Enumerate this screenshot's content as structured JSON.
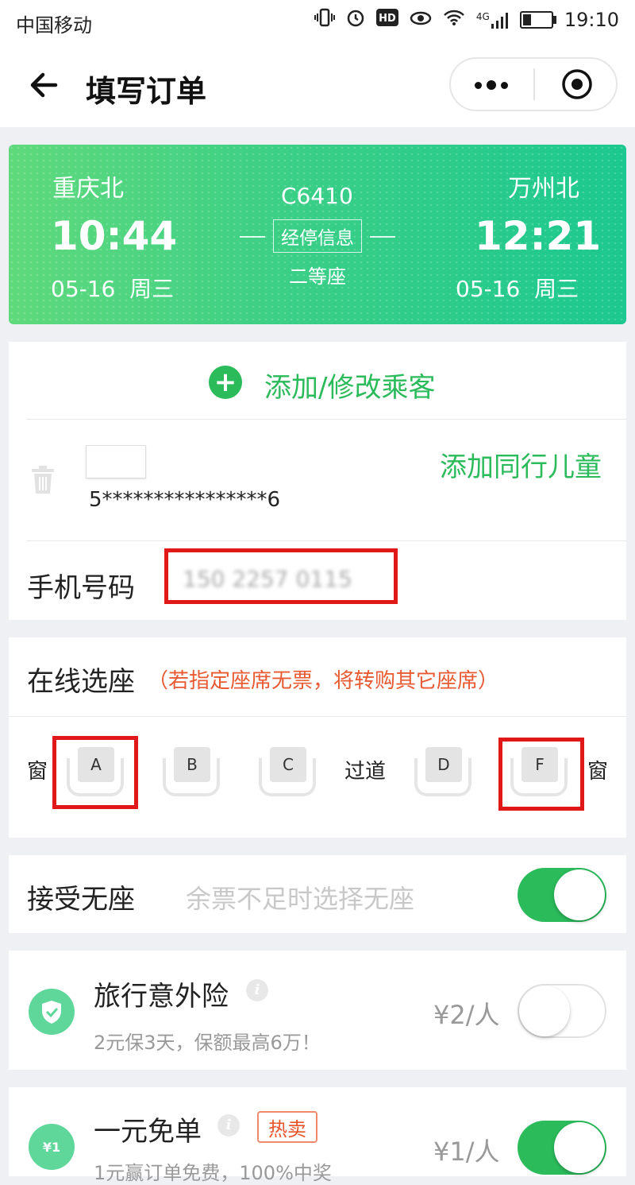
{
  "status_bar": {
    "carrier": "中国移动",
    "network": "4G",
    "time": "19:10"
  },
  "nav": {
    "title": "填写订单"
  },
  "train": {
    "from_station": "重庆北",
    "from_time": "10:44",
    "from_date": "05-16  周三",
    "to_station": "万州北",
    "to_time": "12:21",
    "to_date": "05-16  周三",
    "train_no": "C6410",
    "stop_info_label": "经停信息",
    "seat_class": "二等座"
  },
  "passenger": {
    "add_label": "添加/修改乘客",
    "id_number": "5****************6",
    "add_child_label": "添加同行儿童",
    "phone_label": "手机号码",
    "phone_value": "150 2257 0115"
  },
  "seat_selection": {
    "title": "在线选座",
    "note": "（若指定座席无票，将转购其它座席）",
    "window_label": "窗",
    "aisle_label": "过道",
    "seats": [
      "A",
      "B",
      "C",
      "D",
      "F"
    ],
    "selected": [
      "A",
      "F"
    ]
  },
  "no_seat": {
    "label": "接受无座",
    "hint": "余票不足时选择无座",
    "enabled": true
  },
  "insurance": {
    "title": "旅行意外险",
    "info": "i",
    "subtitle": "2元保3天，保额最高6万！",
    "price": "¥2/人",
    "enabled": false
  },
  "free_order": {
    "title": "一元免单",
    "info": "i",
    "badge": "热卖",
    "icon_text": "¥1",
    "subtitle": "1元赢订单免费，100%中奖",
    "price": "¥1/人",
    "enabled": true
  },
  "colors": {
    "accent": "#2bbb5b",
    "warning": "#e85a32",
    "highlight_box": "#e01818"
  }
}
